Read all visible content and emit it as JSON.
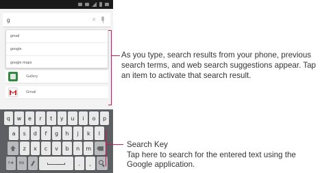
{
  "phone": {
    "search": {
      "query": "g"
    },
    "suggestions": [
      "gmail",
      "google",
      "google maps"
    ],
    "apps": [
      {
        "label": "Gallery",
        "icon": "gallery-icon"
      },
      {
        "label": "Gmail",
        "icon": "gmail-icon"
      }
    ],
    "keyboard": {
      "row1": [
        "q",
        "w",
        "e",
        "r",
        "t",
        "y",
        "u",
        "i",
        "o",
        "p"
      ],
      "row2": [
        "a",
        "s",
        "d",
        "f",
        "g",
        "h",
        "j",
        "k",
        "l"
      ],
      "row3": [
        "z",
        "x",
        "c",
        "v",
        "b",
        "n",
        "m"
      ],
      "sym_label": "?!#",
      "lang_label": "EN",
      "period": ".",
      "comma": ","
    }
  },
  "callouts": {
    "results": "As you type, search results from your phone, previous search terms, and web search suggestions appear. Tap an item to activate that search result.",
    "search_key_title": "Search Key",
    "search_key_desc": "Tap here to search for the entered text using the Google application."
  },
  "colors": {
    "callout_line": "#c2185b",
    "keyboard_bg": "#5d5f63"
  }
}
